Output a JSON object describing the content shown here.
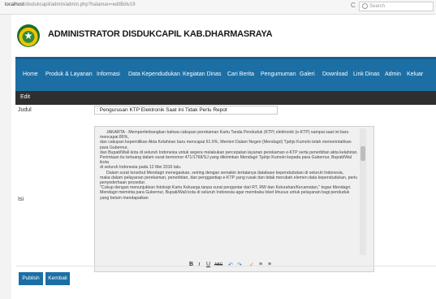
{
  "browser": {
    "url_host": "localhost",
    "url_path": "/disdukcapil/admin/admin.php?halaman=editBdiv19",
    "search_placeholder": "Search"
  },
  "header": {
    "title": "ADMINISTRATOR DISDUKCAPIL KAB.DHARMASRAYA"
  },
  "nav": {
    "items": [
      "Home",
      "Produk & Layanan",
      "Informasi",
      "Data Kependudukan",
      "Kegiatan Dinas",
      "Cari Berita",
      "Pengumuman",
      "Galeri",
      "Download",
      "Link Dinas",
      "Admin",
      "Keluar"
    ]
  },
  "section": {
    "title": "Edit"
  },
  "form": {
    "judul_label": "Judul",
    "judul_value": ": Pengurusan KTP Elektronik Saat Ini Tidak Perlu Repot",
    "isi_label": "Isi",
    "isi_paragraphs": [
      "JAKARTA - Mempertimbangkan bahwa cakupan perekaman Kartu Tanda Penduduk (KTP) elektronik (e-KTP) sampai saat ini baru mencapai 86%,",
      "dan cakupan kepemilikan Akta Kelahiran baru mencapai 61.6%, Menteri Dalam Negeri (Mendagri) Tjahjo Kumolo telah memerintahkan para Gubernur,",
      "dan Bupati/Wali kota di seluruh Indonesia untuk segera melakukan percepatan layanan perekaman e-KTP serta penerbitan akta kelahiran.",
      "Perimtaan itu tertuang dalam surat bernomor 471/1768/SJ yang dikirimkan Mendagri Tjahjo Kumolo kepada para Gubernur, Bupati/Wal ikota",
      "di seluruh Indonesia pada 12 Mei 2016 lalu.",
      "Dalam surat tersebut Mendagri menegaskan, seiring dengan semakin tertatanya database kependudukan di seluruh Indonesia,",
      "maka dalam pelayanan perekaman, penerbitan, dan penggantiap e-KTP yang rusak dan tidak merubah elemen data kependudukan, perlu penyederhaan prosedur.",
      "\"Cukup dengan menunjukkan fotokopi Kartu Keluarga tanpa surat pengantar dari RT, RW dan Kelurahan/Kecamatan,\" tegas Mendagri.",
      "Mendagri meminta para Gubernur, Bupati/Wali kota di seluruh Indonesia agar membuka loket khusus untuk pelayanan bagi penduduk yang belum mendapatkan"
    ],
    "toolbar": [
      "B",
      "I",
      "U",
      "ABC",
      "↶",
      "↷",
      "✓",
      "≡",
      "≡"
    ]
  },
  "buttons": {
    "publish": "Publish",
    "kembali": "Kembali"
  },
  "colors": {
    "nav": "#1c6fa5",
    "edit_bar": "#2f2f2f"
  }
}
